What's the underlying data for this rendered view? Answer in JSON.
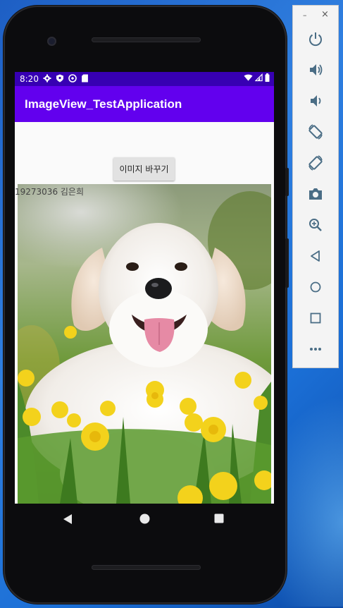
{
  "status_bar": {
    "time": "8:20"
  },
  "app_bar": {
    "title": "ImageView_TestApplication"
  },
  "main": {
    "change_button_label": "이미지 바꾸기",
    "student_label": "19273036 김은희"
  },
  "panel": {
    "minimize_glyph": "–",
    "close_glyph": "×",
    "controls": [
      "power-icon",
      "volume-up-icon",
      "volume-down-icon",
      "rotate-left-icon",
      "rotate-right-icon",
      "camera-icon",
      "zoom-icon",
      "back-icon",
      "home-icon",
      "overview-icon",
      "more-icon"
    ]
  },
  "colors": {
    "status_bar": "#3700b3",
    "app_bar": "#6200ee",
    "icon": "#4a6d85"
  }
}
